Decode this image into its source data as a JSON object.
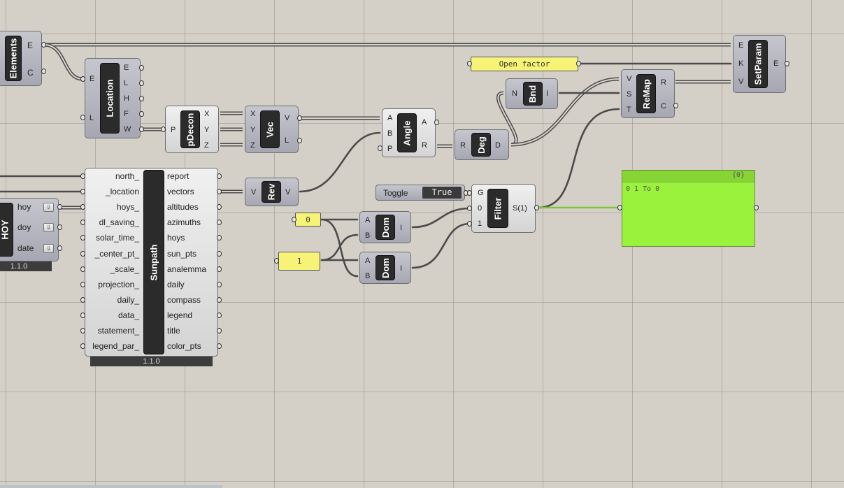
{
  "components": {
    "elements": {
      "name": "Elements",
      "outputs": [
        "E",
        "C"
      ]
    },
    "location": {
      "name": "Location",
      "inputs": [
        "E",
        "L"
      ],
      "outputs": [
        "E",
        "L",
        "H",
        "F",
        "W"
      ]
    },
    "pdecon": {
      "name": "pDecon",
      "inputs": [
        "P"
      ],
      "outputs": [
        "X",
        "Y",
        "Z"
      ]
    },
    "vec": {
      "name": "Vec",
      "inputs": [
        "X",
        "Y",
        "Z"
      ],
      "outputs": [
        "V",
        "L"
      ]
    },
    "angle": {
      "name": "Angle",
      "inputs": [
        "A",
        "B",
        "P"
      ],
      "outputs": [
        "A",
        "R"
      ]
    },
    "deg": {
      "name": "Deg",
      "inputs": [
        "R"
      ],
      "outputs": [
        "D"
      ]
    },
    "bnd": {
      "name": "Bnd",
      "inputs": [
        "N"
      ],
      "outputs": [
        "I"
      ]
    },
    "remap": {
      "name": "ReMap",
      "inputs": [
        "V",
        "S",
        "T"
      ],
      "outputs": [
        "R",
        "C"
      ]
    },
    "setparam": {
      "name": "SetParam",
      "inputs": [
        "E",
        "K",
        "V"
      ],
      "outputs": [
        "E"
      ]
    },
    "rev": {
      "name": "Rev",
      "inputs": [
        "V"
      ],
      "outputs": [
        "V"
      ]
    },
    "filter": {
      "name": "Filter",
      "inputs": [
        "G",
        "0",
        "1"
      ],
      "outputs": [
        "S(1)"
      ]
    },
    "dom1": {
      "name": "Dom",
      "inputs": [
        "A",
        "B"
      ],
      "outputs": [
        "I"
      ]
    },
    "dom2": {
      "name": "Dom",
      "inputs": [
        "A",
        "B"
      ],
      "outputs": [
        "I"
      ]
    },
    "hoy": {
      "name": "HOY",
      "outputs": [
        "hoy",
        "doy",
        "date"
      ],
      "version": "1.1.0"
    },
    "sunpath": {
      "name": "Sunpath",
      "inputs": [
        "north_",
        "_location",
        "hoys_",
        "dl_saving_",
        "solar_time_",
        "_center_pt_",
        "_scale_",
        "projection_",
        "daily_",
        "data_",
        "statement_",
        "legend_par_"
      ],
      "outputs": [
        "report",
        "vectors",
        "altitudes",
        "azimuths",
        "hoys",
        "sun_pts",
        "analemma",
        "daily",
        "compass",
        "legend",
        "title",
        "color_pts"
      ],
      "version": "1.1.0"
    }
  },
  "panels": {
    "open_factor": "Open factor",
    "zero": "0",
    "one": "1"
  },
  "toggle": {
    "label": "Toggle",
    "value": "True"
  },
  "viewer": {
    "path": "{0}",
    "content": "0 1 To 0"
  },
  "colors": {
    "canvas": "#d4d0c8",
    "panel_yellow": "#f6f377",
    "viewer_green": "#9af23c",
    "component": "#a9a9b5",
    "band": "#2b2b2b"
  }
}
